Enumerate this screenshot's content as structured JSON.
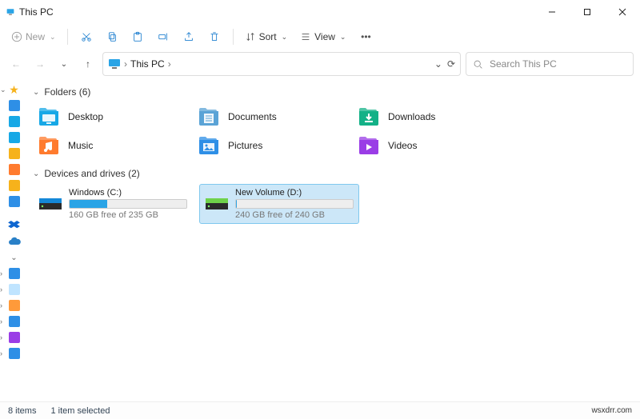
{
  "window": {
    "title": "This PC"
  },
  "toolbar": {
    "new_label": "New",
    "sort_label": "Sort",
    "view_label": "View"
  },
  "breadcrumb": {
    "root": "This PC"
  },
  "search": {
    "placeholder": "Search This PC"
  },
  "groups": {
    "folders_label": "Folders (6)",
    "drives_label": "Devices and drives (2)"
  },
  "folders": [
    {
      "name": "Desktop",
      "icon": "desktop",
      "color": "#17a8e6"
    },
    {
      "name": "Documents",
      "icon": "documents",
      "color": "#5aa3d6"
    },
    {
      "name": "Downloads",
      "icon": "downloads",
      "color": "#13b187"
    },
    {
      "name": "Music",
      "icon": "music",
      "color": "#ff7b2e"
    },
    {
      "name": "Pictures",
      "icon": "pictures",
      "color": "#2e8fe6"
    },
    {
      "name": "Videos",
      "icon": "videos",
      "color": "#9a3de6"
    }
  ],
  "drives": [
    {
      "name": "Windows (C:)",
      "sub": "160 GB free of 235 GB",
      "fill_pct": 32,
      "icon_color": "#1488d8",
      "dark": "#2b2b2b",
      "selected": false
    },
    {
      "name": "New Volume (D:)",
      "sub": "240 GB free of 240 GB",
      "fill_pct": 1,
      "icon_color": "#6fd24a",
      "dark": "#2b2b2b",
      "selected": true
    }
  ],
  "status": {
    "items": "8 items",
    "selected": "1 item selected",
    "right": "wsxdrr.com"
  },
  "sidebar": [
    {
      "kind": "star",
      "color": "#f6b21b",
      "chev": "v"
    },
    {
      "kind": "box",
      "color": "#2e8fe6"
    },
    {
      "kind": "box",
      "color": "#17a8e6"
    },
    {
      "kind": "box",
      "color": "#17a8e6"
    },
    {
      "kind": "box",
      "color": "#f6b21b"
    },
    {
      "kind": "box",
      "color": "#ff7b2e"
    },
    {
      "kind": "box",
      "color": "#f6b21b"
    },
    {
      "kind": "box",
      "color": "#2e8fe6"
    },
    {
      "kind": "gap"
    },
    {
      "kind": "dropbox",
      "color": "#0f66d0"
    },
    {
      "kind": "cloud",
      "color": "#2a80c7"
    },
    {
      "kind": "chev"
    },
    {
      "kind": "box",
      "color": "#2e8fe6",
      "chev": ">"
    },
    {
      "kind": "box",
      "color": "#bfe4ff",
      "chev": ">"
    },
    {
      "kind": "box",
      "color": "#ff9a3a",
      "chev": ">"
    },
    {
      "kind": "box",
      "color": "#2e8fe6",
      "chev": ">"
    },
    {
      "kind": "box",
      "color": "#9a3de6",
      "chev": ">"
    },
    {
      "kind": "box",
      "color": "#2e8fe6",
      "chev": ">"
    }
  ]
}
